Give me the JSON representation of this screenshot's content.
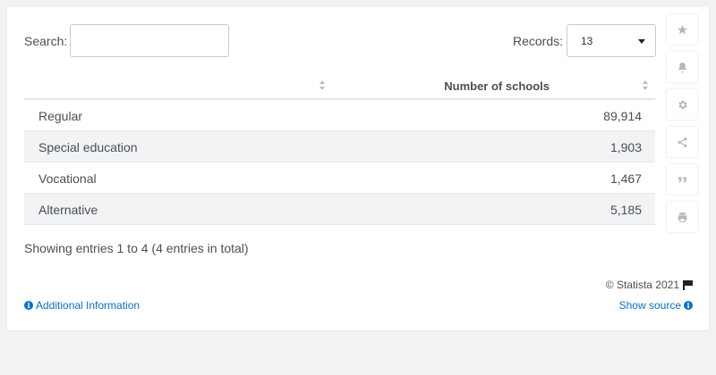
{
  "search": {
    "label": "Search:",
    "value": "",
    "placeholder": ""
  },
  "records": {
    "label": "Records:",
    "selected": "13"
  },
  "table": {
    "columns": [
      "",
      "Number of schools"
    ],
    "rows": [
      {
        "label": "Regular",
        "value": "89,914"
      },
      {
        "label": "Special education",
        "value": "1,903"
      },
      {
        "label": "Vocational",
        "value": "1,467"
      },
      {
        "label": "Alternative",
        "value": "5,185"
      }
    ]
  },
  "footer": {
    "showing": "Showing entries 1 to 4 (4 entries in total)",
    "copyright": "© Statista 2021",
    "additional_info": "Additional Information",
    "show_source": "Show source"
  },
  "sidebar_icons": [
    "star-icon",
    "bell-icon",
    "gear-icon",
    "share-icon",
    "quote-icon",
    "print-icon"
  ],
  "colors": {
    "link": "#0b6fc7",
    "stripe": "#f1f3f5",
    "icon": "#b3b8be"
  }
}
